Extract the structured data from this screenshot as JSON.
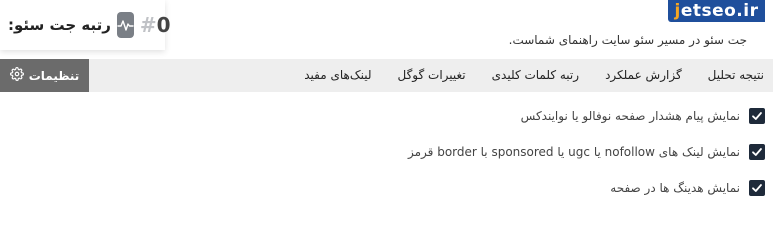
{
  "header": {
    "rank_title": "رتبه جت سئو:",
    "rank_value": "0",
    "rank_prefix": "#",
    "chip_icon": "activity-icon",
    "logo_prefix": "j",
    "logo_rest": "etseo.ir",
    "subtitle": "جت سئو در مسیر سئو سایت راهنمای شماست."
  },
  "tabs": [
    {
      "label": "نتیجه تحلیل"
    },
    {
      "label": "گزارش عملکرد"
    },
    {
      "label": "رتبه کلمات کلیدی"
    },
    {
      "label": "تغییرات گوگل"
    },
    {
      "label": "لینک‌های مفید"
    }
  ],
  "settings": {
    "label": "تنظیمات",
    "icon": "gear-icon"
  },
  "options": [
    {
      "label": "نمایش پیام هشدار صفحه نوفالو یا نوایندکس",
      "checked": true
    },
    {
      "label": "نمایش لینک های nofollow یا ugc یا sponsored با border قرمز",
      "checked": true
    },
    {
      "label": "نمایش هدینگ ها در صفحه",
      "checked": true
    }
  ],
  "colors": {
    "logo_bg": "#1f4f9c",
    "logo_accent": "#f5a623",
    "settings_bg": "#6b6b6b",
    "tabbar_bg": "#eeeeee",
    "checkbox_bg": "#1e2a3a"
  }
}
